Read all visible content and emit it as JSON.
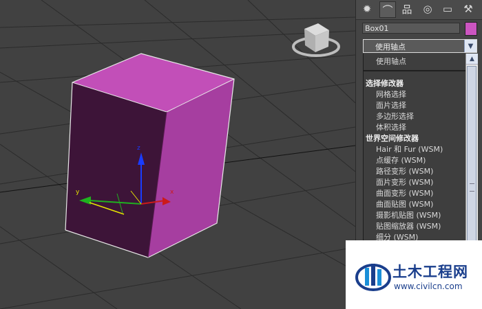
{
  "panel": {
    "tabs": [
      {
        "name": "create-tab",
        "icon": "sun-icon",
        "glyph": "✹"
      },
      {
        "name": "modify-tab",
        "icon": "modify-curve-icon",
        "glyph": "⌒"
      },
      {
        "name": "hierarchy-tab",
        "icon": "hierarchy-icon",
        "glyph": "品"
      },
      {
        "name": "motion-tab",
        "icon": "motion-icon",
        "glyph": "◎"
      },
      {
        "name": "display-tab",
        "icon": "display-icon",
        "glyph": "▭"
      },
      {
        "name": "utilities-tab",
        "icon": "hammer-icon",
        "glyph": "⚒"
      }
    ],
    "object_name": "Box01",
    "object_color": "#cc55c0",
    "modifier_dropdown": {
      "selected": "使用轴点"
    },
    "modifier_list": {
      "selected_item": "使用轴点",
      "sections": [
        {
          "header": "选择修改器",
          "items": [
            "网格选择",
            "面片选择",
            "多边形选择",
            "体积选择"
          ]
        },
        {
          "header": "世界空间修改器",
          "items": [
            "Hair 和 Fur (WSM)",
            "点缓存 (WSM)",
            "路径变形 (WSM)",
            "面片变形 (WSM)",
            "曲面变形 (WSM)",
            "曲面贴图 (WSM)",
            "摄影机贴图 (WSM)",
            "贴图缩放器 (WSM)",
            "细分 (WSM)"
          ]
        }
      ]
    }
  },
  "viewport": {
    "gizmo_labels": {
      "x": "x",
      "y": "y",
      "z": "z"
    },
    "box_color": "#c24fb8"
  },
  "watermark": {
    "title": "土木工程网",
    "url": "www.civilcn.com"
  }
}
